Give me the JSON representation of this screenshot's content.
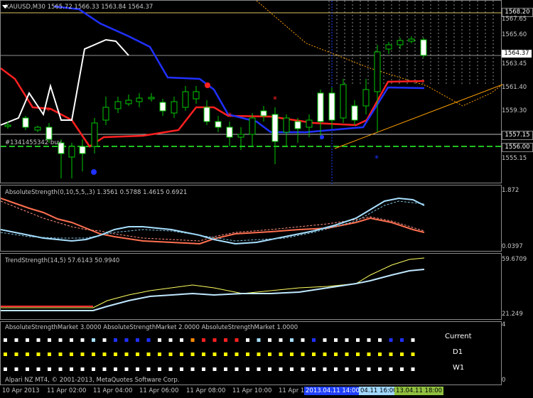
{
  "chart": {
    "title": "XAUUSD,M30  1565.72 1566.33 1563.84 1564.37",
    "order_label": "#1341455342 buy",
    "price_axis": [
      "1567.65",
      "1565.60",
      "1563.45",
      "1561.40",
      "1559.30",
      "1557.15",
      "1556.00",
      "1555.15"
    ],
    "price_boxes": {
      "top": "1568.20",
      "current": "1564.37",
      "mid": "1557.15",
      "bottom": "1556.00"
    },
    "colors": {
      "bull": "#00c800",
      "bear": "#ffffff",
      "cloud_red": "#ff2020",
      "cloud_blue": "#2030ff",
      "trend": "#ffa000"
    }
  },
  "ind1": {
    "title": "AbsoluteStrength(0,10,5,5,,3) 1.3561 0.5788 1.4615 0.6921",
    "axis_top": "1.872",
    "axis_bottom": "0.0397"
  },
  "ind2": {
    "title": "TrendStrength(14,5) 57.6143 50.9940",
    "axis_top": "59.6709",
    "axis_bottom": "21.249"
  },
  "ind3": {
    "title": "AbsoluteStrengthMarket 3.0000  AbsoluteStrengthMarket 2.0000  AbsoluteStrengthMarket 1.0000",
    "axis_top": "4",
    "axis_bottom": "0",
    "rows": [
      "Current",
      "D1",
      "W1"
    ],
    "copyright": "Alpari NZ MT4, © 2001-2013, MetaQuotes Software Corp."
  },
  "time_axis": {
    "labels": [
      "10 Apr 2013",
      "11 Apr 02:00",
      "11 Apr 04:00",
      "11 Apr 06:00",
      "11 Apr 08:00",
      "11 Apr 10:00",
      "11 Apr 12"
    ],
    "boxes": [
      "2013.04.11 14:00",
      "04.11 16:00",
      "13.04.11 18:00"
    ]
  }
}
